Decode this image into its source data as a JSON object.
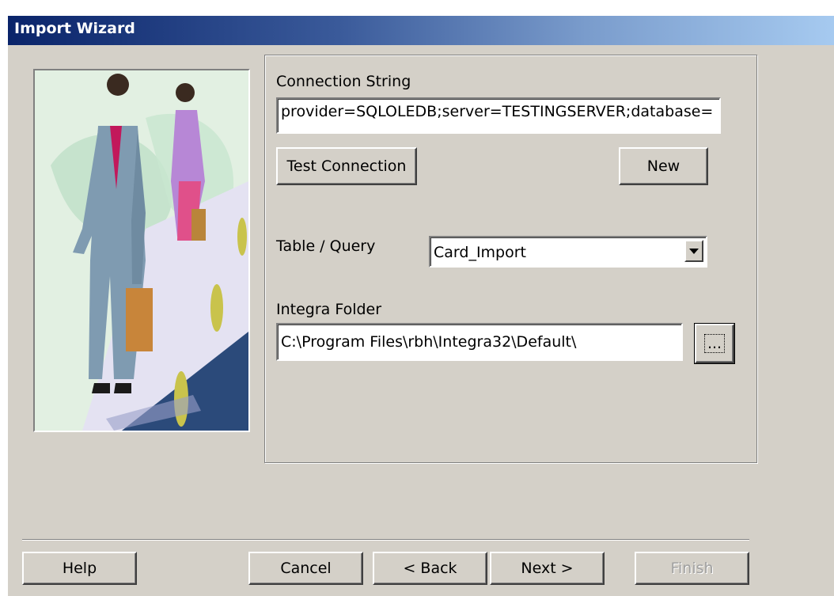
{
  "window": {
    "title": "Import Wizard"
  },
  "form": {
    "connection_label": "Connection String",
    "connection_value": "provider=SQLOLEDB;server=TESTINGSERVER;database=",
    "test_connection_label": "Test Connection",
    "new_label": "New",
    "table_query_label": "Table / Query",
    "table_query_value": "Card_Import",
    "integra_folder_label": "Integra Folder",
    "integra_folder_value": "C:\\Program Files\\rbh\\Integra32\\Default\\",
    "browse_label": "..."
  },
  "footer": {
    "help_label": "Help",
    "cancel_label": "Cancel",
    "back_label": "< Back",
    "next_label": "Next >",
    "finish_label": "Finish"
  },
  "colors": {
    "titlebar_start": "#0a246a",
    "titlebar_end": "#a6caf0",
    "face": "#d4d0c8"
  }
}
